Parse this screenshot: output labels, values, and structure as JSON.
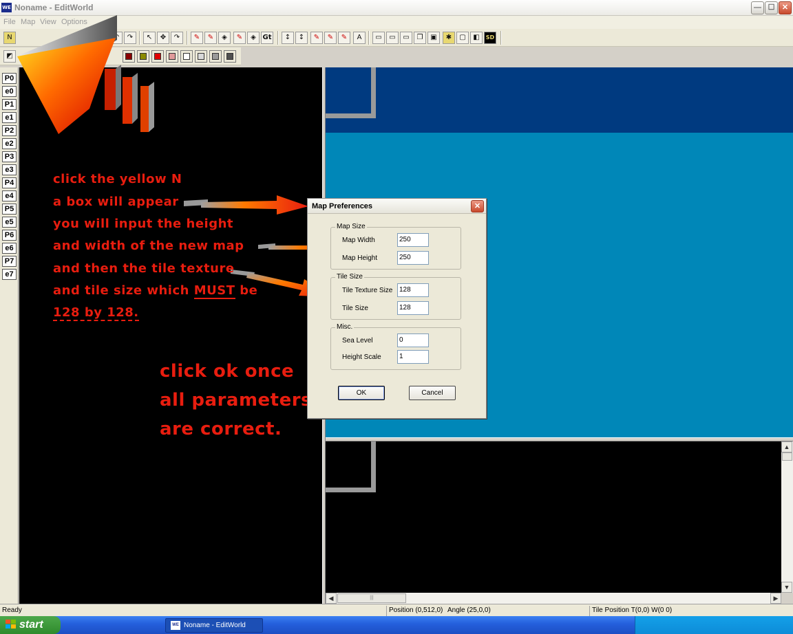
{
  "window": {
    "icon_text": "WE",
    "title": "Noname - EditWorld",
    "minimize_glyph": "—",
    "maximize_glyph": "☐",
    "close_glyph": "✕"
  },
  "menu": [
    "File",
    "Map",
    "View",
    "Options"
  ],
  "toolbar1": {
    "icons": [
      "map-icon",
      "undo-icon",
      "redo-icon",
      "select-arrow-icon",
      "move-icon",
      "rotate-icon",
      "paint-icon",
      "paint-icon",
      "fill-icon",
      "paint-icon",
      "fill-icon",
      "goto-icon",
      "raise-icon",
      "lower-icon",
      "brush-icon",
      "brush-icon",
      "brush-icon",
      "text-icon",
      "grid-icon",
      "grid-icon",
      "copy-icon",
      "paste-icon",
      "delete-icon",
      "new-icon",
      "preview-icon",
      "view-icon",
      "sd-icon"
    ],
    "gt_label": "Gt",
    "sd_label": "SD"
  },
  "toolbar2": {
    "swatch_colors": [
      "#8a0000",
      "#8a8a00",
      "#e00000",
      "#e09a9a",
      "#ffffff",
      "#d8d8d8",
      "#9a9a9a",
      "#505050"
    ]
  },
  "layers": [
    "P0",
    "e0",
    "P1",
    "e1",
    "P2",
    "e2",
    "P3",
    "e3",
    "P4",
    "e4",
    "P5",
    "e5",
    "P6",
    "e6",
    "P7",
    "e7"
  ],
  "dialog": {
    "title": "Map Preferences",
    "close_glyph": "✕",
    "groups": {
      "map_size": {
        "label": "Map Size",
        "width_label": "Map Width",
        "width_value": "250",
        "height_label": "Map Height",
        "height_value": "250"
      },
      "tile_size": {
        "label": "Tile Size",
        "texture_label": "Tile Texture Size",
        "texture_value": "128",
        "size_label": "Tile Size",
        "size_value": "128"
      },
      "misc": {
        "label": "Misc.",
        "sea_label": "Sea Level",
        "sea_value": "0",
        "height_scale_label": "Height Scale",
        "height_scale_value": "1"
      }
    },
    "ok_label": "OK",
    "cancel_label": "Cancel"
  },
  "annotations": {
    "line1": "click the yellow N",
    "line2": "a box will appear",
    "line3": "you will input the height",
    "line4": "and width of the new map",
    "line5": "and then the tile texture",
    "line6_pre": "and tile size which ",
    "line6_must": "MUST",
    "line6_post": " be",
    "line7": "128 by 128.",
    "big1": "click ok once",
    "big2": "all parameters",
    "big3": "are correct.",
    "arrow_color": "#e81d0f"
  },
  "scrollbars": {
    "up_glyph": "▲",
    "down_glyph": "▼",
    "left_glyph": "◀",
    "right_glyph": "▶",
    "grip_glyph": "|||"
  },
  "status": {
    "ready": "Ready",
    "position": "Position (0,512,0)",
    "angle": "Angle (25,0,0)",
    "tile_position": "Tile Position T(0,0) W(0 0)"
  },
  "taskbar": {
    "start_label": "start",
    "task_icon_text": "WE",
    "task_label": "Noname - EditWorld"
  }
}
